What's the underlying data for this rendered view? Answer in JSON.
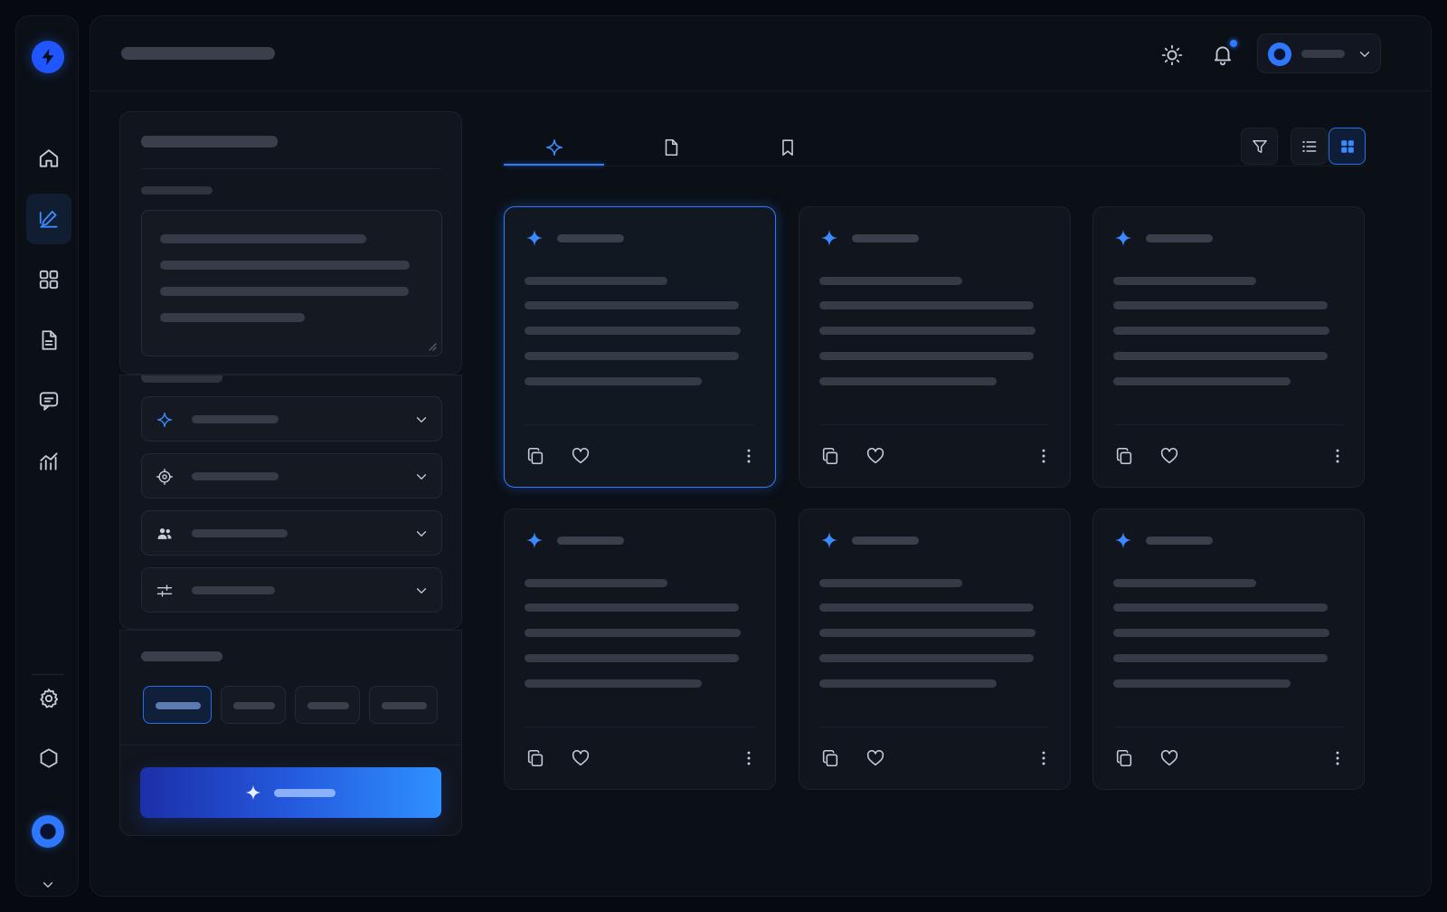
{
  "app": {
    "title": "",
    "accent": "#2f7bff",
    "background": "#06090f"
  },
  "rail": {
    "logo_icon": "lightning-icon",
    "items": [
      {
        "icon": "home-icon",
        "active": false
      },
      {
        "icon": "edit-icon",
        "active": true
      },
      {
        "icon": "grid-icon",
        "active": false
      },
      {
        "icon": "document-icon",
        "active": false
      },
      {
        "icon": "chat-icon",
        "active": false
      },
      {
        "icon": "analytics-icon",
        "active": false
      }
    ],
    "bottom_items": [
      {
        "icon": "settings-icon"
      },
      {
        "icon": "hexagon-icon"
      }
    ]
  },
  "header": {
    "title": "",
    "theme_icon": "sun-icon",
    "notification_icon": "bell-icon",
    "notification_badge": true,
    "user": {
      "name": "",
      "menu_icon": "chevron-down-icon"
    }
  },
  "composer": {
    "heading": "",
    "prompt_label": "",
    "prompt_lines": [
      "",
      "",
      "",
      ""
    ],
    "options": [
      {
        "icon": "sparkle-icon",
        "label": ""
      },
      {
        "icon": "target-icon",
        "label": ""
      },
      {
        "icon": "users-icon",
        "label": ""
      },
      {
        "icon": "sliders-icon",
        "label": ""
      }
    ],
    "length_label": "",
    "length_options": [
      {
        "label": "",
        "active": true
      },
      {
        "label": "",
        "active": false
      },
      {
        "label": "",
        "active": false
      },
      {
        "label": "",
        "active": false
      }
    ],
    "generate_button": {
      "label": "",
      "icon": "sparkle-icon"
    }
  },
  "results": {
    "tabs": [
      {
        "icon": "sparkle-icon",
        "active": true
      },
      {
        "icon": "document-icon",
        "active": false
      },
      {
        "icon": "bookmark-icon",
        "active": false
      }
    ],
    "toolbar": [
      {
        "icon": "filter-icon",
        "active": false
      },
      {
        "icon": "list-icon",
        "active": false
      },
      {
        "icon": "grid-icon",
        "active": true
      }
    ],
    "cards": [
      {
        "title": "",
        "selected": true
      },
      {
        "title": "",
        "selected": false
      },
      {
        "title": "",
        "selected": false
      },
      {
        "title": "",
        "selected": false
      },
      {
        "title": "",
        "selected": false
      },
      {
        "title": "",
        "selected": false
      }
    ],
    "card_actions": [
      "copy-icon",
      "heart-icon",
      "more-vertical-icon"
    ]
  }
}
